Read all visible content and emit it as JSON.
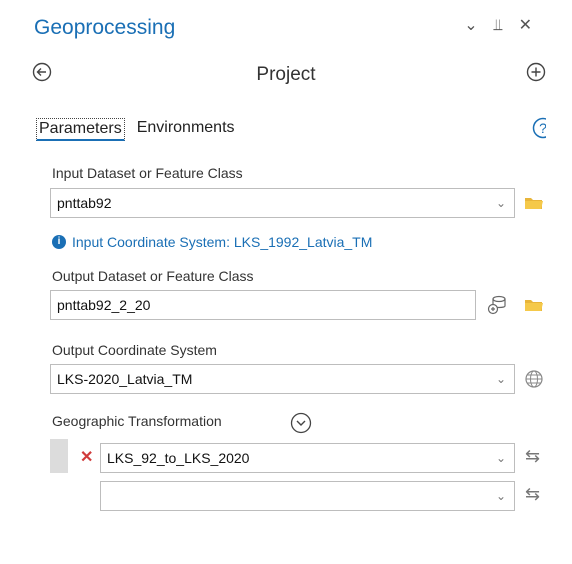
{
  "panel": {
    "title": "Geoprocessing",
    "tool_name": "Project",
    "tabs": [
      {
        "label": "Parameters",
        "active": true
      },
      {
        "label": "Environments",
        "active": false
      }
    ]
  },
  "params": {
    "input_label": "Input Dataset or Feature Class",
    "input_value": "pnttab92",
    "info_text": "Input Coordinate System: LKS_1992_Latvia_TM",
    "output_label": "Output Dataset or Feature Class",
    "output_value": "pnttab92_2_20",
    "ocs_label": "Output Coordinate System",
    "ocs_value": "LKS-2020_Latvia_TM",
    "gt_label": "Geographic Transformation",
    "gt_rows": [
      {
        "value": "LKS_92_to_LKS_2020"
      },
      {
        "value": ""
      }
    ]
  },
  "colors": {
    "accent": "#1a6fb5",
    "error": "#d03b3b",
    "folder": "#e8b53a"
  },
  "icons": {
    "minimize": "chevron-down-icon",
    "pin": "pin-icon",
    "close": "close-icon",
    "back": "back-arrow-icon",
    "add": "plus-circle-icon",
    "help": "help-icon",
    "folder": "folder-icon",
    "globe": "globe-icon",
    "swap": "swap-icon"
  }
}
